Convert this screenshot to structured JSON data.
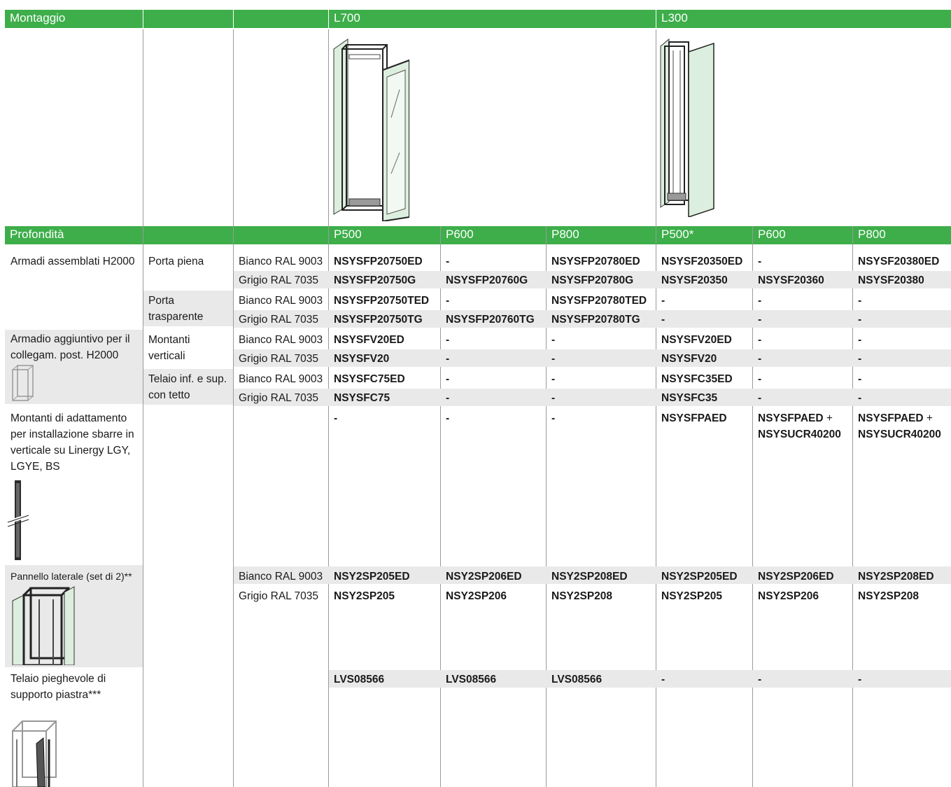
{
  "header1": {
    "montaggio": "Montaggio",
    "l700": "L700",
    "l300": "L300"
  },
  "header2": {
    "profondita": "Profondità",
    "cols": [
      "P500",
      "P600",
      "P800",
      "P500*",
      "P600",
      "P800"
    ]
  },
  "colors": {
    "accent": "#3dae4a",
    "row_gray": "#e9e9e9",
    "panel_green": "#dceedd"
  },
  "rows": {
    "armadi_label": "Armadi assemblati H2000",
    "porta_piena": "Porta piena",
    "porta_trasparente": "Porta trasparente",
    "aggiuntivo_label": "Armadio aggiuntivo per il collegam. post. H2000",
    "montanti_verticali": "Montanti verticali",
    "telaio_tetto": "Telaio inf. e sup. con tetto",
    "adattamento_label": "Montanti di adattamento per installazione sbarre in verticale su Linergy LGY, LGYE,  BS",
    "pannello_label": "Pannello laterale (set di 2)**",
    "pieghevole_label": "Telaio pieghevole di supporto piastra***",
    "bianco": "Bianco RAL 9003",
    "grigio": "Grigio RAL 7035"
  },
  "table": [
    [
      "NSYSFP20750ED",
      "-",
      "NSYSFP20780ED",
      "NSYSF20350ED",
      "-",
      "NSYSF20380ED"
    ],
    [
      "NSYSFP20750G",
      "NSYSFP20760G",
      "NSYSFP20780G",
      "NSYSF20350",
      "NSYSF20360",
      "NSYSF20380"
    ],
    [
      "NSYSFP20750TED",
      "-",
      "NSYSFP20780TED",
      "-",
      "-",
      "-"
    ],
    [
      "NSYSFP20750TG",
      "NSYSFP20760TG",
      "NSYSFP20780TG",
      "-",
      "-",
      "-"
    ],
    [
      "NSYSFV20ED",
      "-",
      "-",
      "NSYSFV20ED",
      "-",
      "-"
    ],
    [
      "NSYSFV20",
      "-",
      "-",
      "NSYSFV20",
      "-",
      "-"
    ],
    [
      "NSYSFC75ED",
      "-",
      "-",
      "NSYSFC35ED",
      "-",
      "-"
    ],
    [
      "NSYSFC75",
      "-",
      "-",
      "NSYSFC35",
      "-",
      "-"
    ]
  ],
  "adattamento": {
    "dash": "-",
    "l300_p500": "NSYSFPAED",
    "l300_p600_a": "NSYSFPAED",
    "l300_p600_b": "NSYSUCR40200",
    "l300_p800_a": "NSYSFPAED",
    "l300_p800_b": "NSYSUCR40200",
    "plus": "+"
  },
  "pannello": [
    [
      "NSY2SP205ED",
      "NSY2SP206ED",
      "NSY2SP208ED",
      "NSY2SP205ED",
      "NSY2SP206ED",
      "NSY2SP208ED"
    ],
    [
      "NSY2SP205",
      "NSY2SP206",
      "NSY2SP208",
      "NSY2SP205",
      "NSY2SP206",
      "NSY2SP208"
    ]
  ],
  "pieghevole": [
    "LVS08566",
    "LVS08566",
    "LVS08566",
    "-",
    "-",
    "-"
  ]
}
